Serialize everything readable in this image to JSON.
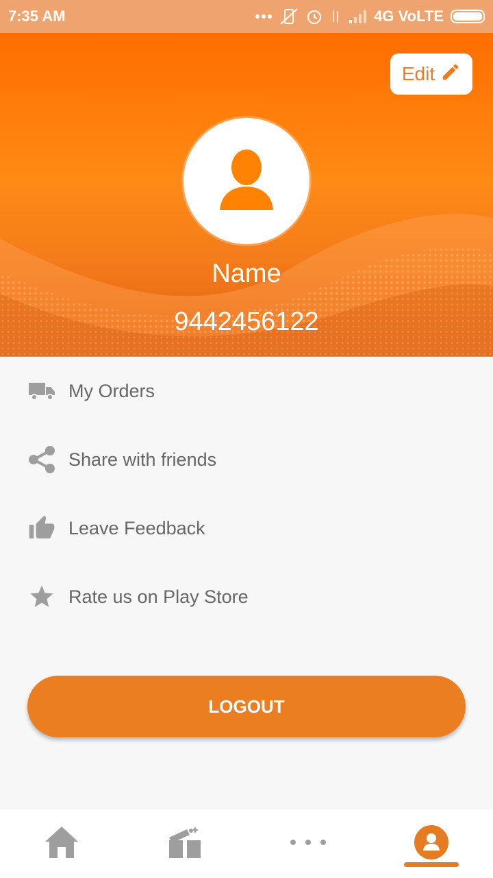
{
  "status_bar": {
    "time": "7:35 AM",
    "network": "4G VoLTE",
    "icons": [
      "dots-icon",
      "vibrate-icon",
      "alarm-icon",
      "data-arrows-icon",
      "signal-icon",
      "battery-icon"
    ]
  },
  "header": {
    "edit_label": "Edit",
    "name": "Name",
    "phone": "9442456122",
    "accent": "#ff7a10"
  },
  "menu": {
    "items": [
      {
        "label": "My Orders",
        "icon": "truck-icon"
      },
      {
        "label": "Share with friends",
        "icon": "share-icon"
      },
      {
        "label": "Leave Feedback",
        "icon": "thumbs-up-icon"
      },
      {
        "label": "Rate us on Play Store",
        "icon": "star-icon"
      }
    ]
  },
  "logout_label": "LOGOUT",
  "bottom_nav": {
    "items": [
      {
        "icon": "home-icon",
        "active": false
      },
      {
        "icon": "gift-icon",
        "active": false
      },
      {
        "icon": "more-icon",
        "active": false
      },
      {
        "icon": "profile-icon",
        "active": true
      }
    ]
  },
  "colors": {
    "status_bar": "#efa46f",
    "button": "#ea7e21",
    "menu_text": "#666666",
    "icon_gray": "#9e9e9e"
  }
}
